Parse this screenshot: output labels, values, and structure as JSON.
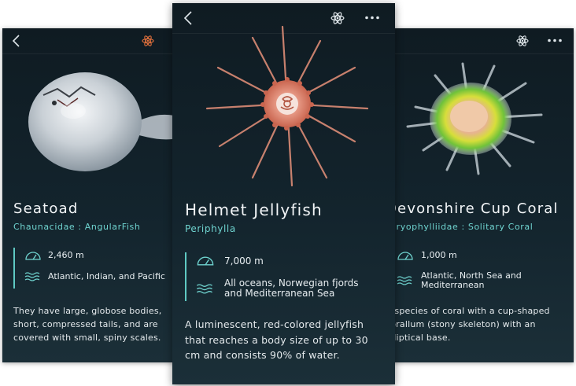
{
  "cards": [
    {
      "title": "Seatoad",
      "subtitle": "Chaunacidae  :  AngularFish",
      "depth": "2,460 m",
      "habitat": "Atlantic, Indian, and Pacific",
      "description": "They have large, globose bodies, short, compressed tails, and are covered with small, spiny scales."
    },
    {
      "title": "Helmet Jellyfish",
      "subtitle": "Periphylla",
      "depth": "7,000 m",
      "habitat": "All oceans, Norwegian fjords and Mediterranean Sea",
      "description": "A luminescent, red-colored jellyfish that reaches a body size of up to 30 cm and consists 90% of water."
    },
    {
      "title": "Devonshire Cup Coral",
      "subtitle": "Caryophylliidae  :  Solitary Coral",
      "depth": "1,000 m",
      "habitat": "Atlantic, North Sea and Mediterranean",
      "description": "A species of coral with a cup-shaped corallum (stony skeleton) with an elliptical base."
    }
  ],
  "icons": {
    "back": "chevron-left-icon",
    "atom": "atom-icon",
    "more": "more-dots-icon",
    "depth": "gauge-icon",
    "habitat": "waves-icon"
  },
  "colors": {
    "accent": "#5fc9c3",
    "atom_active": "#e0703c",
    "card_bg": "#13242d"
  }
}
